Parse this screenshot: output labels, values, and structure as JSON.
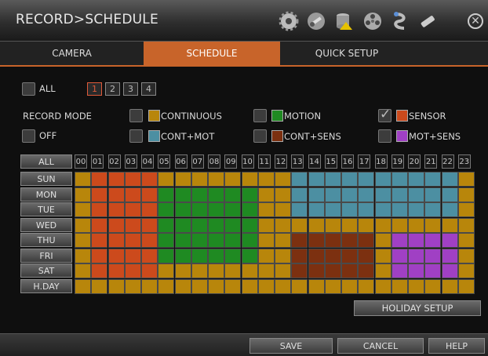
{
  "window": {
    "title": "RECORD>SCHEDULE"
  },
  "toolbar_icons": [
    "gear-icon",
    "wrench-icon",
    "database-icon",
    "film-reel-icon",
    "network-icon",
    "usb-stick-icon",
    "close-icon"
  ],
  "tabs": [
    {
      "label": "CAMERA",
      "active": false
    },
    {
      "label": "SCHEDULE",
      "active": true
    },
    {
      "label": "QUICK SETUP",
      "active": false
    }
  ],
  "all_label": "ALL",
  "pages": [
    "1",
    "2",
    "3",
    "4"
  ],
  "active_page": "1",
  "record_mode": {
    "label": "RECORD MODE",
    "off_label": "OFF",
    "options": [
      {
        "label": "CONTINUOUS",
        "color": "#b8860b",
        "checked": false
      },
      {
        "label": "MOTION",
        "color": "#1f8a22",
        "checked": false
      },
      {
        "label": "SENSOR",
        "color": "#cc4a1c",
        "checked": true
      },
      {
        "label": "CONT+MOT",
        "color": "#4c8fa2",
        "checked": false
      },
      {
        "label": "CONT+SENS",
        "color": "#7c3010",
        "checked": false
      },
      {
        "label": "MOT+SENS",
        "color": "#a040c4",
        "checked": false
      }
    ]
  },
  "grid": {
    "all_label": "ALL",
    "hours": [
      "00",
      "01",
      "02",
      "03",
      "04",
      "05",
      "06",
      "07",
      "08",
      "09",
      "10",
      "11",
      "12",
      "13",
      "14",
      "15",
      "16",
      "17",
      "18",
      "19",
      "20",
      "21",
      "22",
      "23"
    ],
    "days": [
      "SUN",
      "MON",
      "TUE",
      "WED",
      "THU",
      "FRI",
      "SAT",
      "H.DAY"
    ]
  },
  "buttons": {
    "holiday_setup": "HOLIDAY SETUP",
    "save": "SAVE",
    "cancel": "CANCEL",
    "help": "HELP"
  },
  "colors": {
    "accent": "#c8642a",
    "CONT": "#b8860b",
    "SENS": "#cc4a1c",
    "MOT": "#1f8a22",
    "CM": "#4c8fa2",
    "CS": "#7c3010",
    "MS": "#a040c4"
  },
  "schedule": [
    {
      "day": "SUN",
      "blocks": [
        {
          "from": 0,
          "to": 0,
          "mode": "CONT"
        },
        {
          "from": 1,
          "to": 4,
          "mode": "SENS"
        },
        {
          "from": 5,
          "to": 12,
          "mode": "CONT"
        },
        {
          "from": 13,
          "to": 22,
          "mode": "CM"
        },
        {
          "from": 23,
          "to": 23,
          "mode": "CONT"
        }
      ]
    },
    {
      "day": "MON",
      "blocks": [
        {
          "from": 0,
          "to": 0,
          "mode": "CONT"
        },
        {
          "from": 1,
          "to": 4,
          "mode": "SENS"
        },
        {
          "from": 5,
          "to": 10,
          "mode": "MOT"
        },
        {
          "from": 11,
          "to": 12,
          "mode": "CONT"
        },
        {
          "from": 13,
          "to": 22,
          "mode": "CM"
        },
        {
          "from": 23,
          "to": 23,
          "mode": "CONT"
        }
      ]
    },
    {
      "day": "TUE",
      "blocks": [
        {
          "from": 0,
          "to": 0,
          "mode": "CONT"
        },
        {
          "from": 1,
          "to": 4,
          "mode": "SENS"
        },
        {
          "from": 5,
          "to": 10,
          "mode": "MOT"
        },
        {
          "from": 11,
          "to": 12,
          "mode": "CONT"
        },
        {
          "from": 13,
          "to": 22,
          "mode": "CM"
        },
        {
          "from": 23,
          "to": 23,
          "mode": "CONT"
        }
      ]
    },
    {
      "day": "WED",
      "blocks": [
        {
          "from": 0,
          "to": 0,
          "mode": "CONT"
        },
        {
          "from": 1,
          "to": 4,
          "mode": "SENS"
        },
        {
          "from": 5,
          "to": 10,
          "mode": "MOT"
        },
        {
          "from": 11,
          "to": 23,
          "mode": "CONT"
        }
      ]
    },
    {
      "day": "THU",
      "blocks": [
        {
          "from": 0,
          "to": 0,
          "mode": "CONT"
        },
        {
          "from": 1,
          "to": 4,
          "mode": "SENS"
        },
        {
          "from": 5,
          "to": 10,
          "mode": "MOT"
        },
        {
          "from": 11,
          "to": 12,
          "mode": "CONT"
        },
        {
          "from": 13,
          "to": 17,
          "mode": "CS"
        },
        {
          "from": 18,
          "to": 18,
          "mode": "CONT"
        },
        {
          "from": 19,
          "to": 22,
          "mode": "MS"
        },
        {
          "from": 23,
          "to": 23,
          "mode": "CONT"
        }
      ]
    },
    {
      "day": "FRI",
      "blocks": [
        {
          "from": 0,
          "to": 0,
          "mode": "CONT"
        },
        {
          "from": 1,
          "to": 4,
          "mode": "SENS"
        },
        {
          "from": 5,
          "to": 10,
          "mode": "MOT"
        },
        {
          "from": 11,
          "to": 12,
          "mode": "CONT"
        },
        {
          "from": 13,
          "to": 17,
          "mode": "CS"
        },
        {
          "from": 18,
          "to": 18,
          "mode": "CONT"
        },
        {
          "from": 19,
          "to": 22,
          "mode": "MS"
        },
        {
          "from": 23,
          "to": 23,
          "mode": "CONT"
        }
      ]
    },
    {
      "day": "SAT",
      "blocks": [
        {
          "from": 0,
          "to": 0,
          "mode": "CONT"
        },
        {
          "from": 1,
          "to": 4,
          "mode": "SENS"
        },
        {
          "from": 5,
          "to": 12,
          "mode": "CONT"
        },
        {
          "from": 13,
          "to": 17,
          "mode": "CS"
        },
        {
          "from": 18,
          "to": 18,
          "mode": "CONT"
        },
        {
          "from": 19,
          "to": 22,
          "mode": "MS"
        },
        {
          "from": 23,
          "to": 23,
          "mode": "CONT"
        }
      ]
    },
    {
      "day": "H.DAY",
      "blocks": [
        {
          "from": 0,
          "to": 23,
          "mode": "CONT"
        }
      ]
    }
  ]
}
